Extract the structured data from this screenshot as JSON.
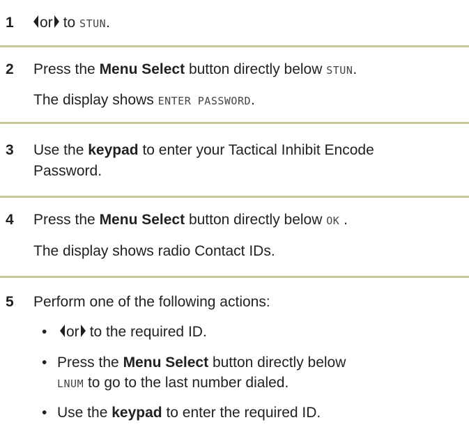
{
  "steps": [
    {
      "number": "1",
      "or_text": "or",
      "to_text": "to",
      "lcd_target": "STUN",
      "period": "."
    },
    {
      "number": "2",
      "pre": "Press the",
      "bold": "Menu Select",
      "post": "button directly below",
      "lcd": "STUN",
      "period": ".",
      "result_pre": "The display shows",
      "result_lcd": "ENTER PASSWORD",
      "result_period": "."
    },
    {
      "number": "3",
      "pre": "Use the",
      "bold": "keypad",
      "post": "to enter your Tactical Inhibit Encode",
      "line2": "Password."
    },
    {
      "number": "4",
      "pre": "Press the",
      "bold": "Menu Select",
      "post": "button directly below",
      "lcd": "OK",
      "period": " .",
      "result": "The display shows radio Contact IDs."
    },
    {
      "number": "5",
      "text": "Perform one of the following actions:",
      "bullets": [
        {
          "or_text": "or",
          "post": "to the required ID."
        },
        {
          "pre": "Press the",
          "bold": "Menu Select",
          "post": "button directly below",
          "lcd": "LNUM",
          "line2_post": "to go to the last number dialed."
        },
        {
          "pre": "Use the",
          "bold": "keypad",
          "post": "to enter the required ID."
        }
      ],
      "bullet_glyph": "•"
    }
  ],
  "colors": {
    "divider": "#c8c79a",
    "text": "#231f20"
  }
}
